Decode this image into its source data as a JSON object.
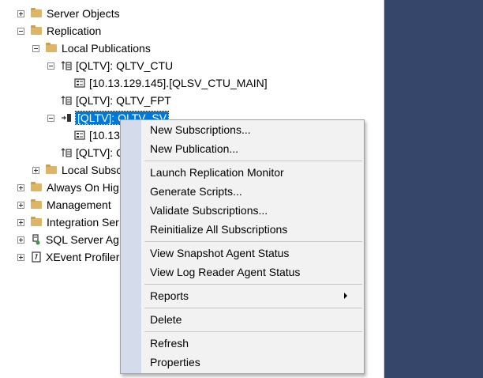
{
  "tree": {
    "server_objects": "Server Objects",
    "replication": "Replication",
    "local_publications": "Local Publications",
    "pub_ctu": "[QLTV]: QLTV_CTU",
    "sub_ctu": "[10.13.129.145].[QLSV_CTU_MAIN]",
    "pub_fpt": "[QLTV]: QLTV_FPT",
    "pub_sv": "[QLTV]: QLTV_SV",
    "sub_sv": "[10.13",
    "pub_other": "[QLTV]: Q",
    "local_subscriptions": "Local Subsc",
    "always_on": "Always On Hig",
    "management": "Management",
    "integration": "Integration Ser",
    "sql_agent": "SQL Server Ag",
    "xevent": "XEvent Profiler"
  },
  "context_menu": {
    "new_subscriptions": "New Subscriptions...",
    "new_publication": "New Publication...",
    "launch_monitor": "Launch Replication Monitor",
    "generate_scripts": "Generate Scripts...",
    "validate_subscriptions": "Validate Subscriptions...",
    "reinitialize": "Reinitialize All Subscriptions",
    "view_snapshot": "View Snapshot Agent Status",
    "view_log_reader": "View Log Reader Agent Status",
    "reports": "Reports",
    "delete": "Delete",
    "refresh": "Refresh",
    "properties": "Properties"
  },
  "colors": {
    "selection": "#0078d7",
    "right_panel": "#36456a",
    "menu_bg": "#f2f2f2",
    "folder": "#dcb567"
  }
}
